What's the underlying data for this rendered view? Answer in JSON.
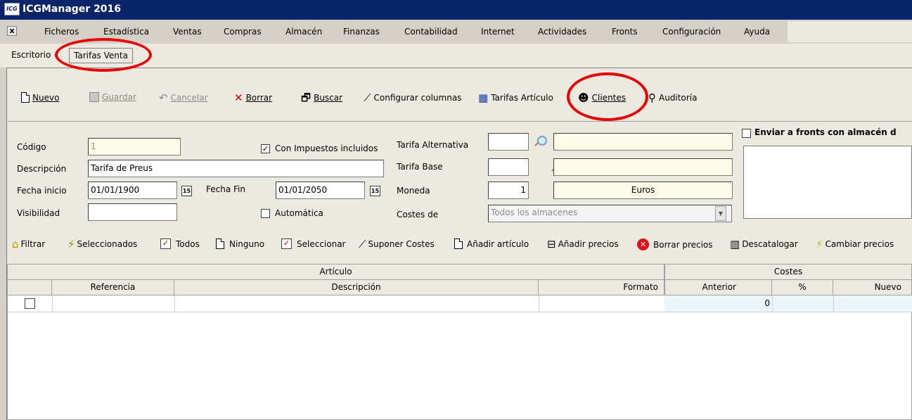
{
  "window": {
    "title": "ICGManager 2016",
    "logo_text": "ICG"
  },
  "menu": {
    "close_label": "x",
    "items": [
      "Ficheros",
      "Estadística",
      "Ventas",
      "Compras",
      "Almacén",
      "Finanzas",
      "Contabilidad",
      "Internet",
      "Actividades",
      "Fronts",
      "Configuración",
      "Ayuda"
    ]
  },
  "tabs": {
    "desktop": "Escritorio",
    "active": "Tarifas Venta"
  },
  "toolbar": {
    "nuevo": "Nuevo",
    "guardar": "Guardar",
    "cancelar": "Cancelar",
    "borrar": "Borrar",
    "buscar": "Buscar",
    "configurar": "Configurar columnas",
    "tarifas_articulo": "Tarifas Artículo",
    "clientes": "Clientes",
    "auditoria": "Auditoría"
  },
  "form": {
    "codigo_label": "Código",
    "codigo_value": "1",
    "descripcion_label": "Descripción",
    "descripcion_value": "Tarifa de Preus",
    "fecha_inicio_label": "Fecha inicio",
    "fecha_inicio_value": "01/01/1900",
    "fecha_fin_label": "Fecha Fin",
    "fecha_fin_value": "01/01/2050",
    "calendar_label": "15",
    "visibilidad_label": "Visibilidad",
    "visibilidad_value": "",
    "con_impuestos_label": "Con Impuestos incluidos",
    "con_impuestos_checked": "✓",
    "automatica_label": "Automática",
    "tarifa_alternativa_label": "Tarifa Alternativa",
    "tarifa_base_label": "Tarifa Base",
    "moneda_label": "Moneda",
    "moneda_code": "1",
    "moneda_name": "Euros",
    "costes_label": "Costes de",
    "costes_value": "Todos los almacenes",
    "enviar_fronts_label": "Enviar a fronts con almacén d"
  },
  "grid_toolbar": {
    "filtrar": "Filtrar",
    "seleccionados": "Seleccionados",
    "todos": "Todos",
    "ninguno": "Ninguno",
    "seleccionar": "Seleccionar",
    "suponer_costes": "Suponer Costes",
    "anadir_articulo": "Añadir artículo",
    "anadir_precios": "Añadir precios",
    "borrar_precios": "Borrar precios",
    "descatalogar": "Descatalogar",
    "cambiar_precios": "Cambiar precios"
  },
  "grid": {
    "group_articulo": "Artículo",
    "group_costes": "Costes",
    "columns": [
      "Referencia",
      "Descripción",
      "Formato",
      "Anterior",
      "%",
      "Nuevo"
    ],
    "rows": [
      {
        "referencia": "",
        "descripcion": "",
        "formato": "",
        "anterior": "0",
        "pct": "",
        "nuevo": ""
      }
    ]
  },
  "colors": {
    "titlebar": "#0a246a",
    "highlight_circle": "#e60000",
    "panel": "#ece9e0",
    "readonly_field": "#fffbe8"
  }
}
